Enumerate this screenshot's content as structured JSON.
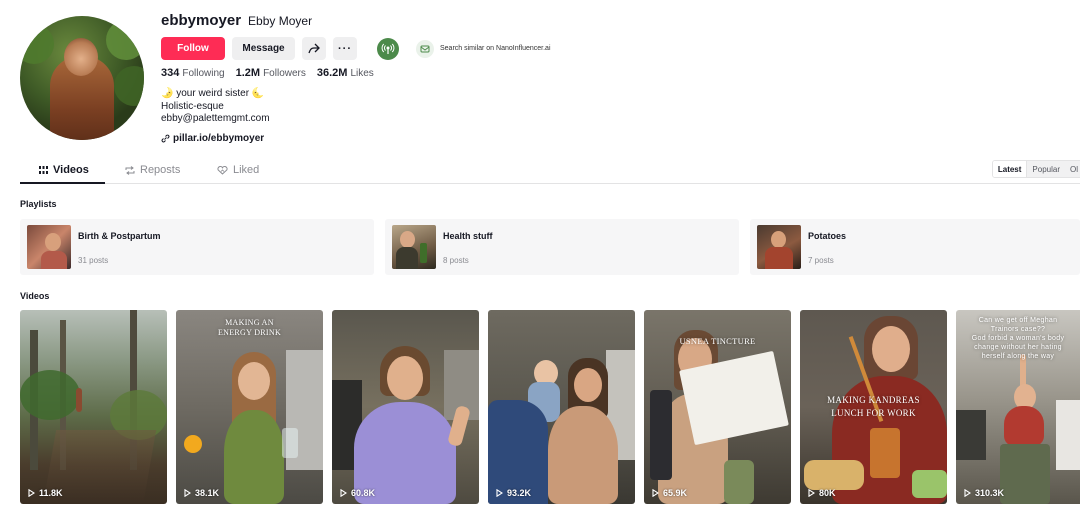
{
  "profile": {
    "username": "ebbymoyer",
    "nickname": "Ebby Moyer",
    "follow_label": "Follow",
    "message_label": "Message",
    "nano_label": "Search similar on NanoInfluencer.ai",
    "stats": {
      "following": "334",
      "following_label": "Following",
      "followers": "1.2M",
      "followers_label": "Followers",
      "likes": "36.2M",
      "likes_label": "Likes"
    },
    "bio": [
      "🌛 your weird sister 🌜",
      "Holistic-esque",
      "ebby@palettemgmt.com"
    ],
    "link": "pillar.io/ebbymoyer"
  },
  "tabs": [
    {
      "label": "Videos",
      "icon": "grid-icon",
      "active": true
    },
    {
      "label": "Reposts",
      "icon": "repost-icon",
      "active": false
    },
    {
      "label": "Liked",
      "icon": "liked-icon",
      "active": false
    }
  ],
  "sort": [
    "Latest",
    "Popular",
    "Ol"
  ],
  "playlists_title": "Playlists",
  "playlists": [
    {
      "name": "Birth & Postpartum",
      "count": "31 posts"
    },
    {
      "name": "Health stuff",
      "count": "8 posts"
    },
    {
      "name": "Potatoes",
      "count": "7 posts"
    }
  ],
  "videos_title": "Videos",
  "videos": [
    {
      "views": "11.8K",
      "caption": ""
    },
    {
      "views": "38.1K",
      "caption": "MAKING AN\nENERGY DRINK"
    },
    {
      "views": "60.8K",
      "caption": ""
    },
    {
      "views": "93.2K",
      "caption": ""
    },
    {
      "views": "65.9K",
      "caption": "USNEA TINCTURE"
    },
    {
      "views": "80K",
      "caption": "MAKING KANDREAS\nLUNCH FOR WORK"
    },
    {
      "views": "310.3K",
      "caption": "Can we get off Meghan\nTrainors case??\nGod forbid a woman's body\nchange without her hating\nherself along the way"
    }
  ],
  "colors": {
    "follow": "#fe2c55",
    "text": "#161823",
    "muted": "#8a8b91"
  }
}
